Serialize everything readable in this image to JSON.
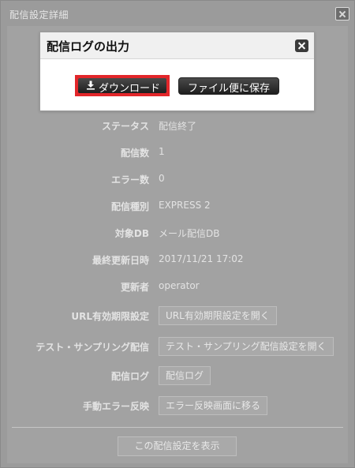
{
  "dialog": {
    "title": "配信設定詳細",
    "close_icon": "close-icon"
  },
  "modal": {
    "title": "配信ログの出力",
    "close_icon": "close-icon",
    "download_label": "ダウンロード",
    "download_icon": "download-icon",
    "save_label": "ファイル便に保存",
    "highlight_color": "#e2262a"
  },
  "details": [
    {
      "label": "ステータス",
      "value": "配信終了"
    },
    {
      "label": "配信数",
      "value": "1"
    },
    {
      "label": "エラー数",
      "value": "0"
    },
    {
      "label": "配信種別",
      "value": "EXPRESS 2"
    },
    {
      "label": "対象DB",
      "value": "メール配信DB"
    },
    {
      "label": "最終更新日時",
      "value": "2017/11/21 17:02"
    },
    {
      "label": "更新者",
      "value": "operator"
    }
  ],
  "actions": [
    {
      "label": "URL有効期限設定",
      "button": "URL有効期限設定を開く"
    },
    {
      "label": "テスト・サンプリング配信",
      "button": "テスト・サンプリング配信設定を開く"
    },
    {
      "label": "配信ログ",
      "button": "配信ログ"
    },
    {
      "label": "手動エラー反映",
      "button": "エラー反映画面に移る"
    }
  ],
  "footer": {
    "show_button": "この配信設定を表示"
  }
}
